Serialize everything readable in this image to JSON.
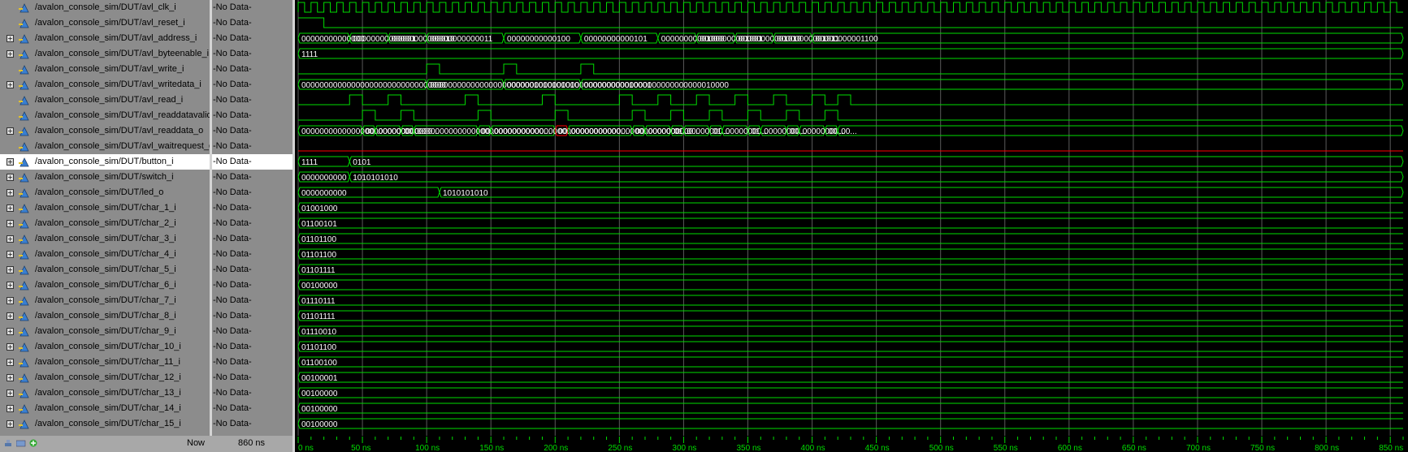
{
  "signals": [
    {
      "name": "/avalon_console_sim/DUT/avl_clk_i",
      "value": "-No Data-",
      "expandable": false,
      "type": "clock"
    },
    {
      "name": "/avalon_console_sim/DUT/avl_reset_i",
      "value": "-No Data-",
      "expandable": false,
      "type": "bit"
    },
    {
      "name": "/avalon_console_sim/DUT/avl_address_i",
      "value": "-No Data-",
      "expandable": true,
      "type": "bus"
    },
    {
      "name": "/avalon_console_sim/DUT/avl_byteenable_i",
      "value": "-No Data-",
      "expandable": true,
      "type": "bus"
    },
    {
      "name": "/avalon_console_sim/DUT/avl_write_i",
      "value": "-No Data-",
      "expandable": false,
      "type": "bit"
    },
    {
      "name": "/avalon_console_sim/DUT/avl_writedata_i",
      "value": "-No Data-",
      "expandable": true,
      "type": "bus"
    },
    {
      "name": "/avalon_console_sim/DUT/avl_read_i",
      "value": "-No Data-",
      "expandable": false,
      "type": "bit"
    },
    {
      "name": "/avalon_console_sim/DUT/avl_readdatavalid_o",
      "value": "-No Data-",
      "expandable": false,
      "type": "bit"
    },
    {
      "name": "/avalon_console_sim/DUT/avl_readdata_o",
      "value": "-No Data-",
      "expandable": true,
      "type": "bus"
    },
    {
      "name": "/avalon_console_sim/DUT/avl_waitrequest_o",
      "value": "-No Data-",
      "expandable": false,
      "type": "bit"
    },
    {
      "name": "/avalon_console_sim/DUT/button_i",
      "value": "-No Data-",
      "expandable": true,
      "type": "bus",
      "selected": true
    },
    {
      "name": "/avalon_console_sim/DUT/switch_i",
      "value": "-No Data-",
      "expandable": true,
      "type": "bus"
    },
    {
      "name": "/avalon_console_sim/DUT/led_o",
      "value": "-No Data-",
      "expandable": true,
      "type": "bus"
    },
    {
      "name": "/avalon_console_sim/DUT/char_1_i",
      "value": "-No Data-",
      "expandable": true,
      "type": "bus"
    },
    {
      "name": "/avalon_console_sim/DUT/char_2_i",
      "value": "-No Data-",
      "expandable": true,
      "type": "bus"
    },
    {
      "name": "/avalon_console_sim/DUT/char_3_i",
      "value": "-No Data-",
      "expandable": true,
      "type": "bus"
    },
    {
      "name": "/avalon_console_sim/DUT/char_4_i",
      "value": "-No Data-",
      "expandable": true,
      "type": "bus"
    },
    {
      "name": "/avalon_console_sim/DUT/char_5_i",
      "value": "-No Data-",
      "expandable": true,
      "type": "bus"
    },
    {
      "name": "/avalon_console_sim/DUT/char_6_i",
      "value": "-No Data-",
      "expandable": true,
      "type": "bus"
    },
    {
      "name": "/avalon_console_sim/DUT/char_7_i",
      "value": "-No Data-",
      "expandable": true,
      "type": "bus"
    },
    {
      "name": "/avalon_console_sim/DUT/char_8_i",
      "value": "-No Data-",
      "expandable": true,
      "type": "bus"
    },
    {
      "name": "/avalon_console_sim/DUT/char_9_i",
      "value": "-No Data-",
      "expandable": true,
      "type": "bus"
    },
    {
      "name": "/avalon_console_sim/DUT/char_10_i",
      "value": "-No Data-",
      "expandable": true,
      "type": "bus"
    },
    {
      "name": "/avalon_console_sim/DUT/char_11_i",
      "value": "-No Data-",
      "expandable": true,
      "type": "bus"
    },
    {
      "name": "/avalon_console_sim/DUT/char_12_i",
      "value": "-No Data-",
      "expandable": true,
      "type": "bus"
    },
    {
      "name": "/avalon_console_sim/DUT/char_13_i",
      "value": "-No Data-",
      "expandable": true,
      "type": "bus"
    },
    {
      "name": "/avalon_console_sim/DUT/char_14_i",
      "value": "-No Data-",
      "expandable": true,
      "type": "bus"
    },
    {
      "name": "/avalon_console_sim/DUT/char_15_i",
      "value": "-No Data-",
      "expandable": true,
      "type": "bus"
    }
  ],
  "waveform": {
    "time_range_ns": [
      0,
      860
    ],
    "clock_period_ns": 10,
    "reset_low_at_ns": 20,
    "waitrequest_level": "0",
    "avl_address_i": [
      {
        "t": 0,
        "label": "00000000000000"
      },
      {
        "t": 40,
        "label": "00000000000001"
      },
      {
        "t": 70,
        "label": "00000000000010"
      },
      {
        "t": 100,
        "label": "00000000000011"
      },
      {
        "t": 160,
        "label": "00000000000100"
      },
      {
        "t": 220,
        "label": "00000000000101"
      },
      {
        "t": 280,
        "label": "00000000001000"
      },
      {
        "t": 310,
        "label": "00000000001001"
      },
      {
        "t": 340,
        "label": "00000000001010"
      },
      {
        "t": 370,
        "label": "00000000001011"
      },
      {
        "t": 400,
        "label": "00000000001100"
      }
    ],
    "avl_byteenable_i": [
      {
        "t": 0,
        "label": "1111"
      }
    ],
    "avl_writedata_i": [
      {
        "t": 0,
        "label": "00000000000000000000000000000000"
      },
      {
        "t": 100,
        "label": "000000000000000000000001010101010"
      },
      {
        "t": 160,
        "label": "00000000000000000000000000010001"
      },
      {
        "t": 220,
        "label": "00000000000000000000000000010000"
      }
    ],
    "avl_readdata_o": [
      {
        "t": 0,
        "label": "00000000000000000000000000000..."
      },
      {
        "t": 50,
        "label": "00..."
      },
      {
        "t": 60,
        "label": "000000000..."
      },
      {
        "t": 80,
        "label": "00..."
      },
      {
        "t": 90,
        "label": "0000000000000000000000000000..."
      },
      {
        "t": 140,
        "label": "00..."
      },
      {
        "t": 150,
        "label": "0000000000000000000000000000..."
      },
      {
        "t": 200,
        "label": "00...",
        "highlight": true
      },
      {
        "t": 210,
        "label": "000000000000000000000000000..."
      },
      {
        "t": 260,
        "label": "00..."
      },
      {
        "t": 270,
        "label": "00000000..."
      },
      {
        "t": 290,
        "label": "01..."
      },
      {
        "t": 300,
        "label": "00000000..."
      },
      {
        "t": 320,
        "label": "01..."
      },
      {
        "t": 330,
        "label": "00000000..."
      },
      {
        "t": 350,
        "label": "01..."
      },
      {
        "t": 360,
        "label": "00000000..."
      },
      {
        "t": 380,
        "label": "00..."
      },
      {
        "t": 390,
        "label": "00000000..."
      },
      {
        "t": 410,
        "label": "00..."
      },
      {
        "t": 420,
        "label": "00..."
      }
    ],
    "avl_write_i": [
      {
        "t": 0,
        "v": 0
      },
      {
        "t": 100,
        "v": 1
      },
      {
        "t": 110,
        "v": 0
      },
      {
        "t": 160,
        "v": 1
      },
      {
        "t": 170,
        "v": 0
      },
      {
        "t": 220,
        "v": 1
      },
      {
        "t": 230,
        "v": 0
      }
    ],
    "avl_read_i": [
      {
        "t": 0,
        "v": 0
      },
      {
        "t": 40,
        "v": 1
      },
      {
        "t": 50,
        "v": 0
      },
      {
        "t": 70,
        "v": 1
      },
      {
        "t": 80,
        "v": 0
      },
      {
        "t": 130,
        "v": 1
      },
      {
        "t": 140,
        "v": 0
      },
      {
        "t": 190,
        "v": 1
      },
      {
        "t": 200,
        "v": 0
      },
      {
        "t": 250,
        "v": 1
      },
      {
        "t": 260,
        "v": 0
      },
      {
        "t": 280,
        "v": 1
      },
      {
        "t": 290,
        "v": 0
      },
      {
        "t": 310,
        "v": 1
      },
      {
        "t": 320,
        "v": 0
      },
      {
        "t": 340,
        "v": 1
      },
      {
        "t": 350,
        "v": 0
      },
      {
        "t": 370,
        "v": 1
      },
      {
        "t": 380,
        "v": 0
      },
      {
        "t": 400,
        "v": 1
      },
      {
        "t": 410,
        "v": 0
      },
      {
        "t": 420,
        "v": 1
      },
      {
        "t": 430,
        "v": 0
      }
    ],
    "avl_readdatavalid_o": [
      {
        "t": 0,
        "v": 0
      },
      {
        "t": 50,
        "v": 1
      },
      {
        "t": 60,
        "v": 0
      },
      {
        "t": 80,
        "v": 1
      },
      {
        "t": 90,
        "v": 0
      },
      {
        "t": 140,
        "v": 1
      },
      {
        "t": 150,
        "v": 0
      },
      {
        "t": 200,
        "v": 1
      },
      {
        "t": 210,
        "v": 0
      },
      {
        "t": 260,
        "v": 1
      },
      {
        "t": 270,
        "v": 0
      },
      {
        "t": 290,
        "v": 1
      },
      {
        "t": 300,
        "v": 0
      },
      {
        "t": 320,
        "v": 1
      },
      {
        "t": 330,
        "v": 0
      },
      {
        "t": 350,
        "v": 1
      },
      {
        "t": 360,
        "v": 0
      },
      {
        "t": 380,
        "v": 1
      },
      {
        "t": 390,
        "v": 0
      },
      {
        "t": 410,
        "v": 1
      },
      {
        "t": 420,
        "v": 0
      }
    ],
    "button_i": [
      {
        "t": 0,
        "label": "1111"
      },
      {
        "t": 40,
        "label": "0101"
      }
    ],
    "switch_i": [
      {
        "t": 0,
        "label": "0000000000"
      },
      {
        "t": 40,
        "label": "1010101010"
      }
    ],
    "led_o": [
      {
        "t": 0,
        "label": "0000000000"
      },
      {
        "t": 110,
        "label": "1010101010"
      }
    ],
    "char_values": [
      "01001000",
      "01100101",
      "01101100",
      "01101100",
      "01101111",
      "00100000",
      "01110111",
      "01101111",
      "01110010",
      "01101100",
      "01100100",
      "00100001",
      "00100000",
      "00100000",
      "00100000"
    ]
  },
  "timeline": {
    "now_label": "Now",
    "now_time": "860 ns",
    "ticks": [
      "0 ns",
      "50 ns",
      "100 ns",
      "150 ns",
      "200 ns",
      "250 ns",
      "300 ns",
      "350 ns",
      "400 ns",
      "450 ns",
      "500 ns",
      "550 ns",
      "600 ns",
      "650 ns",
      "700 ns",
      "750 ns",
      "800 ns",
      "850 ns"
    ]
  },
  "colors": {
    "wave": "#00dd00",
    "selected_bg": "#ffffff",
    "panel_bg": "#8c8c8c",
    "cursor_red": "#ff0000",
    "grid": "#5a5a5a"
  }
}
